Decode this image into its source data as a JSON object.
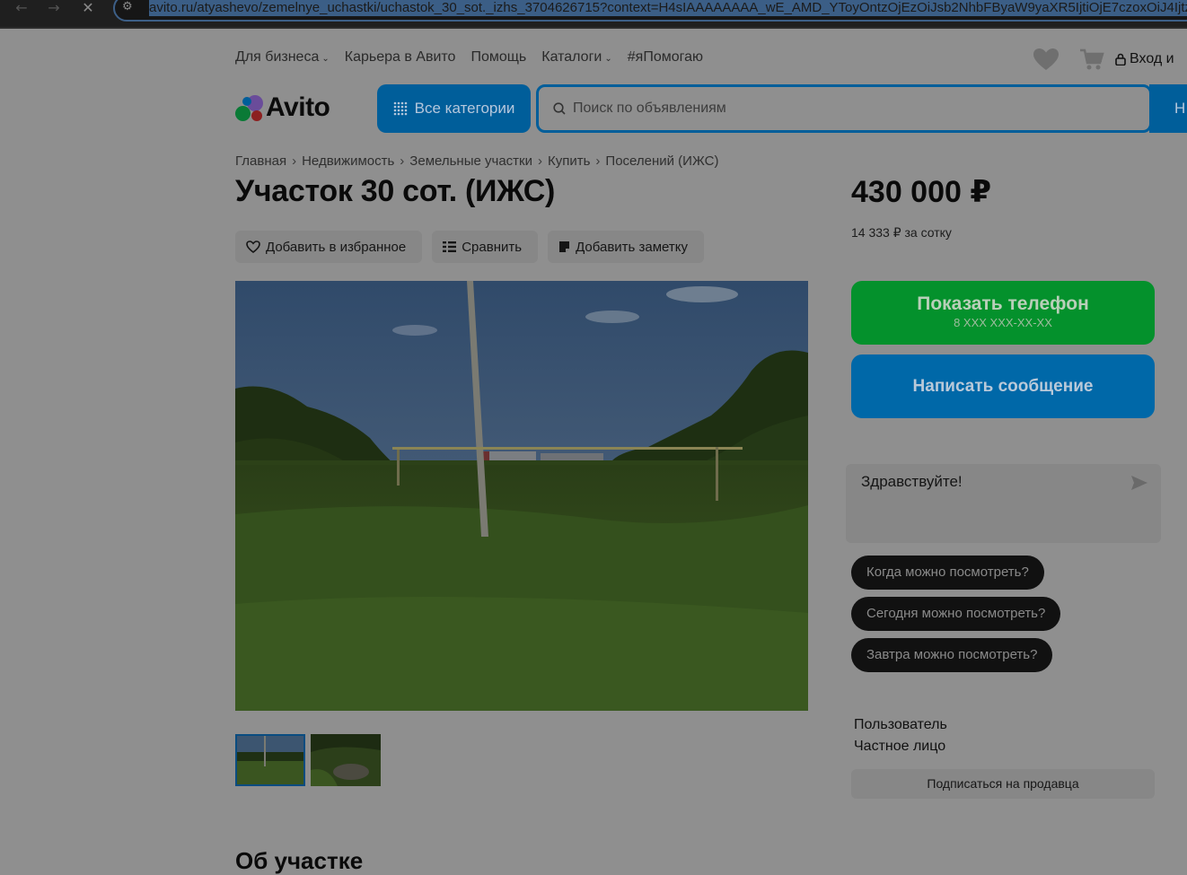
{
  "browser": {
    "url": "avito.ru/atyashevo/zemelnye_uchastki/uchastok_30_sot._izhs_3704626715?context=H4sIAAAAAAAA_wE_AMD_YToyOntzOjEzOiJsb2NhbFByaW9yaXR5IjtiOjE7czoxOiJ4IjtzOjE2OiJ2N"
  },
  "top_nav": {
    "items": [
      "Для бизнеса",
      "Карьера в Авито",
      "Помощь",
      "Каталоги",
      "#яПомогаю"
    ],
    "login": "Вход и"
  },
  "header": {
    "logo_text": "Avito",
    "all_categories": "Все категории",
    "search_placeholder": "Поиск по объявлениям",
    "find_button": "Н"
  },
  "breadcrumbs": [
    "Главная",
    "Недвижимость",
    "Земельные участки",
    "Купить",
    "Поселений (ИЖС)"
  ],
  "listing": {
    "title": "Участок 30 сот. (ИЖС)",
    "actions": [
      "Добавить в избранное",
      "Сравнить",
      "Добавить заметку"
    ],
    "about_heading": "Об участке"
  },
  "price": {
    "value": "430 000 ₽",
    "per_unit": "14 333 ₽ за сотку"
  },
  "contact": {
    "show_phone": "Показать телефон",
    "phone_mask": "8 XXX XXX-XX-XX",
    "write_message": "Написать сообщение",
    "chat_text": "Здравствуйте!",
    "quick_questions": [
      "Когда можно посмотреть?",
      "Сегодня можно посмотреть?",
      "Завтра можно посмотреть?"
    ]
  },
  "seller": {
    "name": "Пользователь",
    "type": "Частное лицо",
    "subscribe": "Подписаться на продавца"
  },
  "colors": {
    "page_dim": "#8f8f8f",
    "brand_blue": "#005e9a",
    "green_button": "#04912c",
    "message_button": "#0068a8",
    "chip_bg": "#111111"
  }
}
